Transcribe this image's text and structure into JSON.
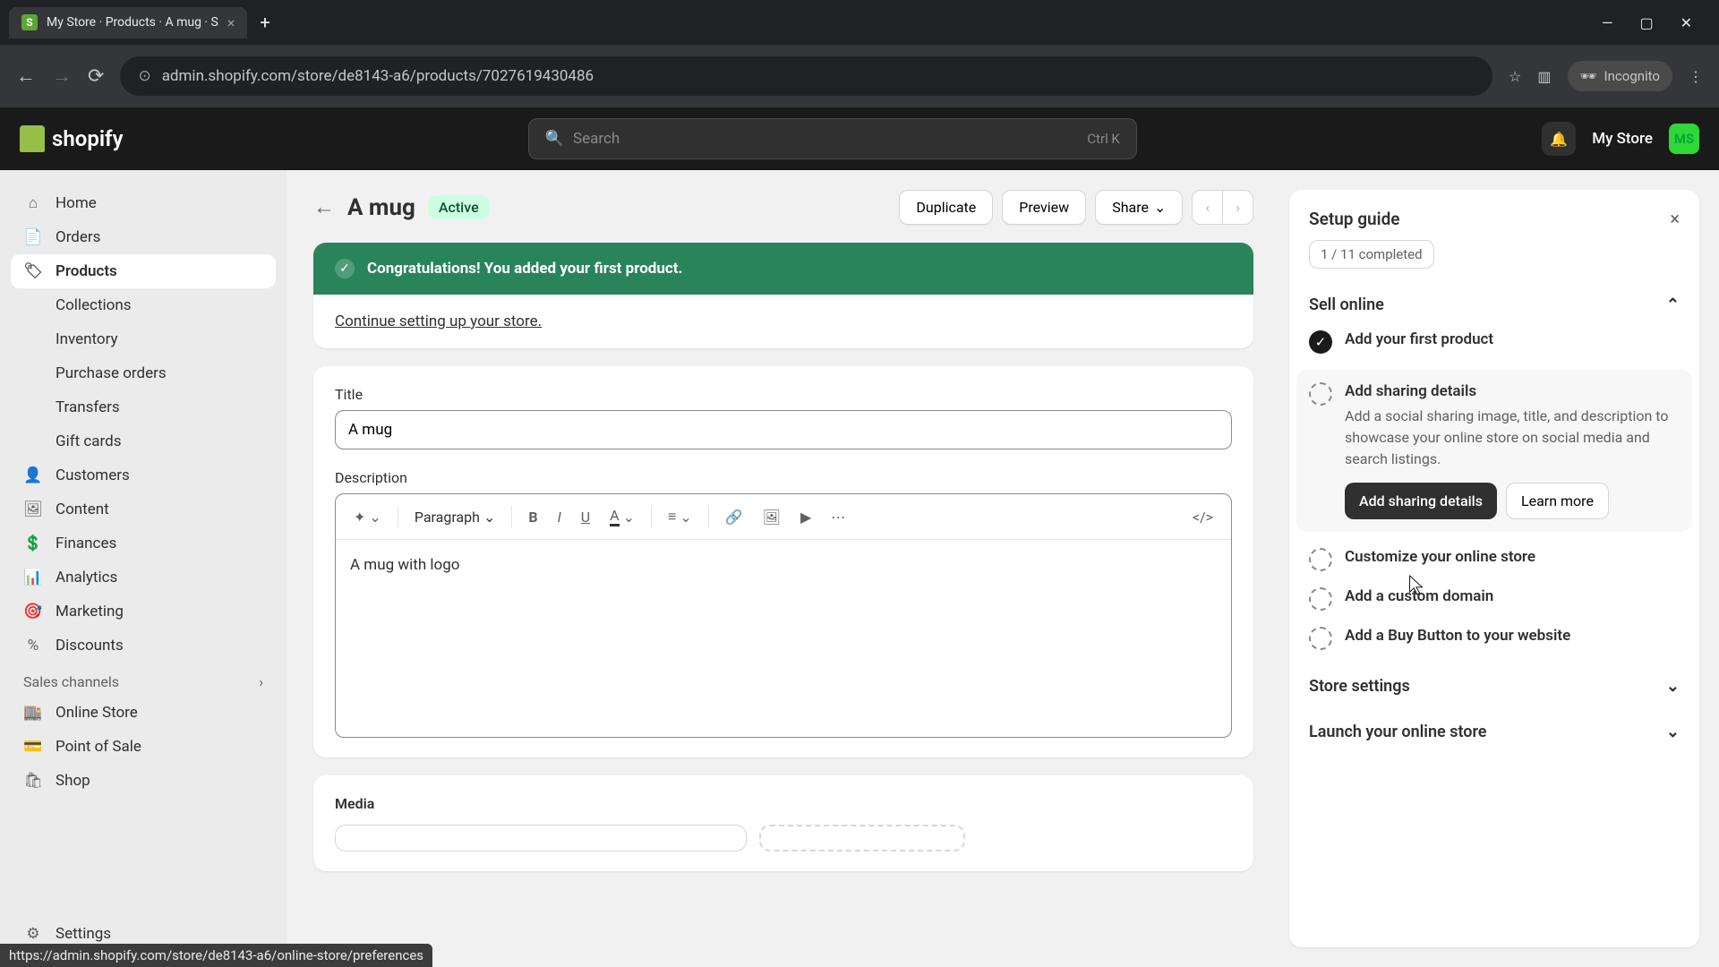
{
  "browser": {
    "tab_title": "My Store · Products · A mug · S",
    "url": "admin.shopify.com/store/de8143-a6/products/7027619430486",
    "incognito_label": "Incognito",
    "status_url": "https://admin.shopify.com/store/de8143-a6/online-store/preferences"
  },
  "topbar": {
    "brand": "shopify",
    "search_placeholder": "Search",
    "search_kbd": "Ctrl K",
    "store_name": "My Store",
    "avatar_initials": "MS"
  },
  "sidebar": {
    "items": [
      {
        "label": "Home"
      },
      {
        "label": "Orders"
      },
      {
        "label": "Products"
      },
      {
        "label": "Collections"
      },
      {
        "label": "Inventory"
      },
      {
        "label": "Purchase orders"
      },
      {
        "label": "Transfers"
      },
      {
        "label": "Gift cards"
      },
      {
        "label": "Customers"
      },
      {
        "label": "Content"
      },
      {
        "label": "Finances"
      },
      {
        "label": "Analytics"
      },
      {
        "label": "Marketing"
      },
      {
        "label": "Discounts"
      }
    ],
    "channels_heading": "Sales channels",
    "channels": [
      {
        "label": "Online Store"
      },
      {
        "label": "Point of Sale"
      },
      {
        "label": "Shop"
      }
    ],
    "settings_label": "Settings"
  },
  "page": {
    "title": "A mug",
    "status": "Active",
    "actions": {
      "duplicate": "Duplicate",
      "preview": "Preview",
      "share": "Share"
    },
    "banner_title": "Congratulations! You added your first product.",
    "banner_link": "Continue setting up your store.",
    "title_label": "Title",
    "title_value": "A mug",
    "desc_label": "Description",
    "desc_value": "A mug with logo",
    "paragraph_label": "Paragraph",
    "media_label": "Media"
  },
  "setup": {
    "title": "Setup guide",
    "progress": "1 / 11 completed",
    "section1": "Sell online",
    "tasks": [
      {
        "label": "Add your first product"
      },
      {
        "label": "Add sharing details",
        "desc": "Add a social sharing image, title, and description to showcase your online store on social media and search listings.",
        "primary": "Add sharing details",
        "secondary": "Learn more"
      },
      {
        "label": "Customize your online store"
      },
      {
        "label": "Add a custom domain"
      },
      {
        "label": "Add a Buy Button to your website"
      }
    ],
    "section2": "Store settings",
    "section3": "Launch your online store"
  }
}
